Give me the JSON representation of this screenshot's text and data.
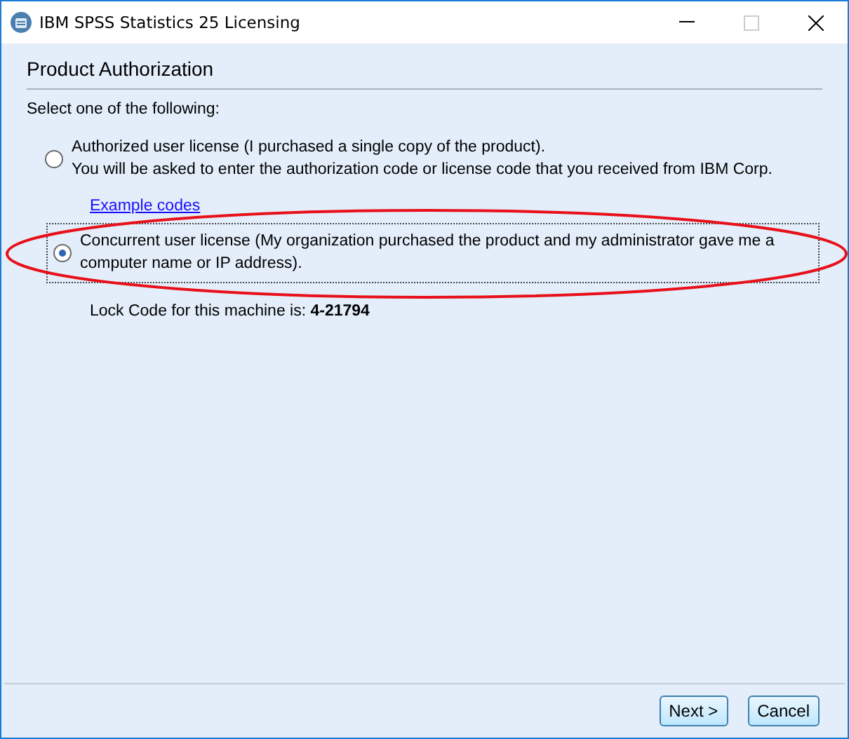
{
  "window": {
    "title": "IBM SPSS Statistics 25 Licensing"
  },
  "heading": "Product Authorization",
  "prompt": "Select one of the following:",
  "options": [
    {
      "lines": [
        "Authorized user license (I purchased a single copy of the product).",
        "You will be asked to enter the authorization code or license code that you received from IBM Corp."
      ],
      "selected": false,
      "link": "Example codes"
    },
    {
      "lines": [
        "Concurrent user license (My organization purchased the product and my administrator gave me a computer name or IP address)."
      ],
      "selected": true
    }
  ],
  "lock_code": "Lock Code for this machine is: **4-21794**",
  "annotation": {
    "kind": "ellipse"
  },
  "buttons": [
    "Next >",
    "Cancel"
  ]
}
